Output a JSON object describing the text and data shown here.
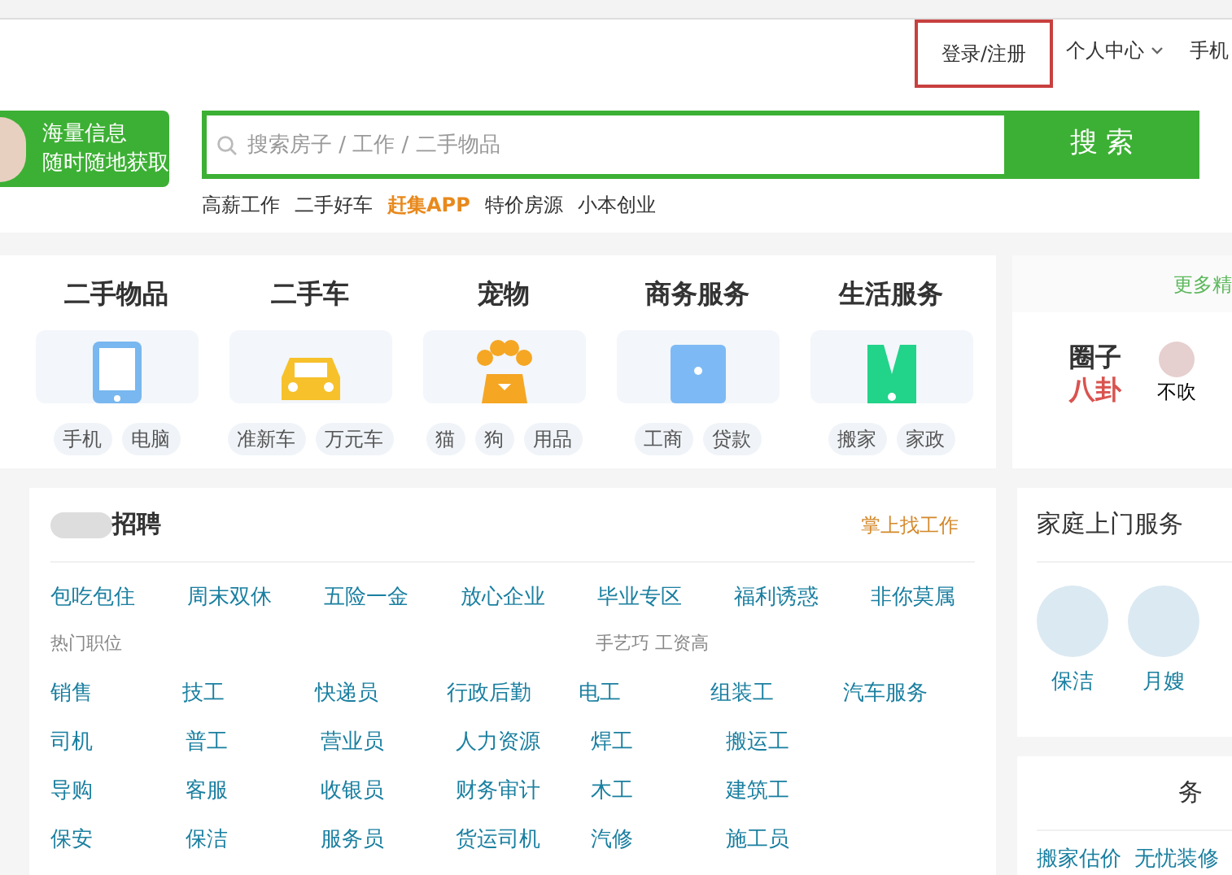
{
  "header": {
    "login": "登录/注册",
    "user_center": "个人中心",
    "mobile": "手机"
  },
  "banner": {
    "line1": "海量信息",
    "line2": "随时随地获取"
  },
  "search": {
    "placeholder": "搜索房子 / 工作 / 二手物品",
    "button": "搜 索"
  },
  "hot_links": [
    {
      "label": "高薪工作",
      "highlight": false
    },
    {
      "label": "二手好车",
      "highlight": false
    },
    {
      "label": "赶集APP",
      "highlight": true
    },
    {
      "label": "特价房源",
      "highlight": false
    },
    {
      "label": "小本创业",
      "highlight": false
    }
  ],
  "categories": [
    {
      "title": "二手物品",
      "kind": "tablet",
      "tags": [
        "手机",
        "电脑"
      ]
    },
    {
      "title": "二手车",
      "kind": "car",
      "tags": [
        "准新车",
        "万元车"
      ]
    },
    {
      "title": "宠物",
      "kind": "paw",
      "tags": [
        "猫",
        "狗",
        "用品"
      ]
    },
    {
      "title": "商务服务",
      "kind": "folder",
      "tags": [
        "工商",
        "贷款"
      ]
    },
    {
      "title": "生活服务",
      "kind": "vest",
      "tags": [
        "搬家",
        "家政"
      ]
    }
  ],
  "side_panel": {
    "more": "更多精",
    "logo_top": "圈子",
    "logo_bottom": "八卦",
    "user": "不吹"
  },
  "jobs": {
    "title": "招聘",
    "app_link": "掌上找工作",
    "tags": [
      "包吃包住",
      "周末双休",
      "五险一金",
      "放心企业",
      "毕业专区",
      "福利诱惑",
      "非你莫属"
    ],
    "section_1": "热门职位",
    "section_2": "手艺巧 工资高",
    "rows": [
      [
        "销售",
        "技工",
        "快递员",
        "行政后勤",
        "电工",
        "组装工",
        "汽车服务"
      ],
      [
        "司机",
        "普工",
        "营业员",
        "人力资源",
        "焊工",
        "搬运工"
      ],
      [
        "导购",
        "客服",
        "收银员",
        "财务审计",
        "木工",
        "建筑工"
      ],
      [
        "保安",
        "保洁",
        "服务员",
        "货运司机",
        "汽修",
        "施工员"
      ]
    ]
  },
  "home_service": {
    "title": "家庭上门服务",
    "items": [
      "保洁",
      "月嫂"
    ]
  },
  "second_card": {
    "title": "务",
    "links": [
      "搬家估价",
      "无忧装修"
    ]
  }
}
